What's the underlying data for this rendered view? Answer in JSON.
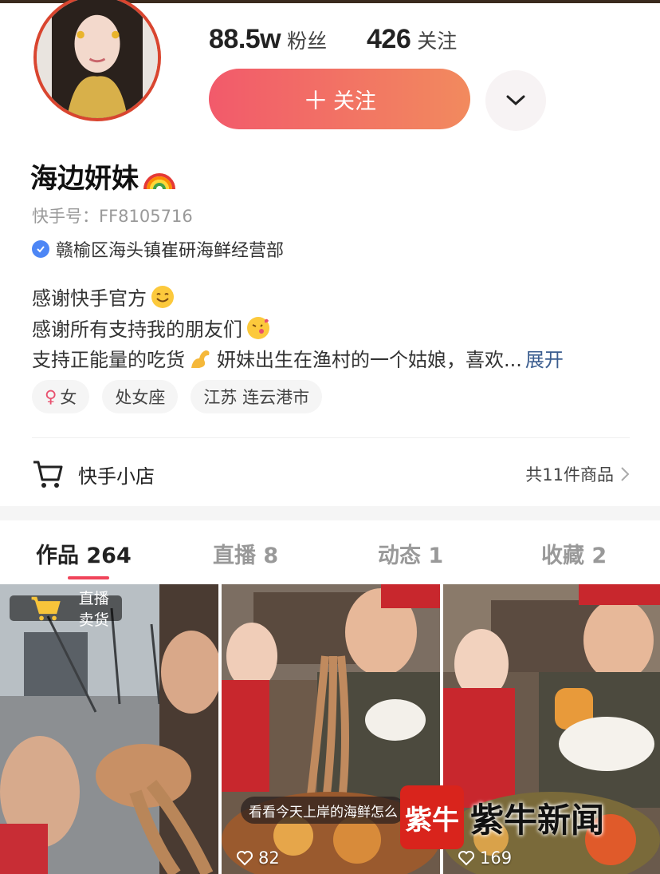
{
  "profile": {
    "followers_value": "88.5w",
    "followers_label": "粉丝",
    "following_value": "426",
    "following_label": "关注",
    "follow_button": "关注",
    "name": "海边妍妹",
    "kuaishou_id": "快手号：FF8105716",
    "verified_text": "赣榆区海头镇崔研海鲜经营部",
    "bio_lines": [
      "感谢快手官方",
      "感谢所有支持我的朋友们",
      "支持正能量的吃货",
      "妍妹出生在渔村的一个姑娘，喜欢..."
    ],
    "expand_label": "展开",
    "tags": [
      "女",
      "处女座",
      "江苏 连云港市"
    ]
  },
  "shop": {
    "label": "快手小店",
    "count": "共11件商品"
  },
  "tabs": [
    {
      "label": "作品 264"
    },
    {
      "label": "直播 8"
    },
    {
      "label": "动态 1"
    },
    {
      "label": "收藏 2"
    }
  ],
  "videos": [
    {
      "badge": "直播卖货",
      "likes": ""
    },
    {
      "caption": "看看今天上岸的海鲜怎么",
      "likes": "82"
    },
    {
      "likes": "169"
    }
  ],
  "watermark": {
    "logo": "紫牛",
    "text": "紫牛新闻"
  },
  "colors": {
    "accent": "#f0445a",
    "follow_gradient_start": "#f25a6b",
    "follow_gradient_end": "#f28a5e",
    "avatar_ring": "#d9452f",
    "verified_blue": "#4d86f5",
    "expand_link": "#3b5d8f"
  }
}
